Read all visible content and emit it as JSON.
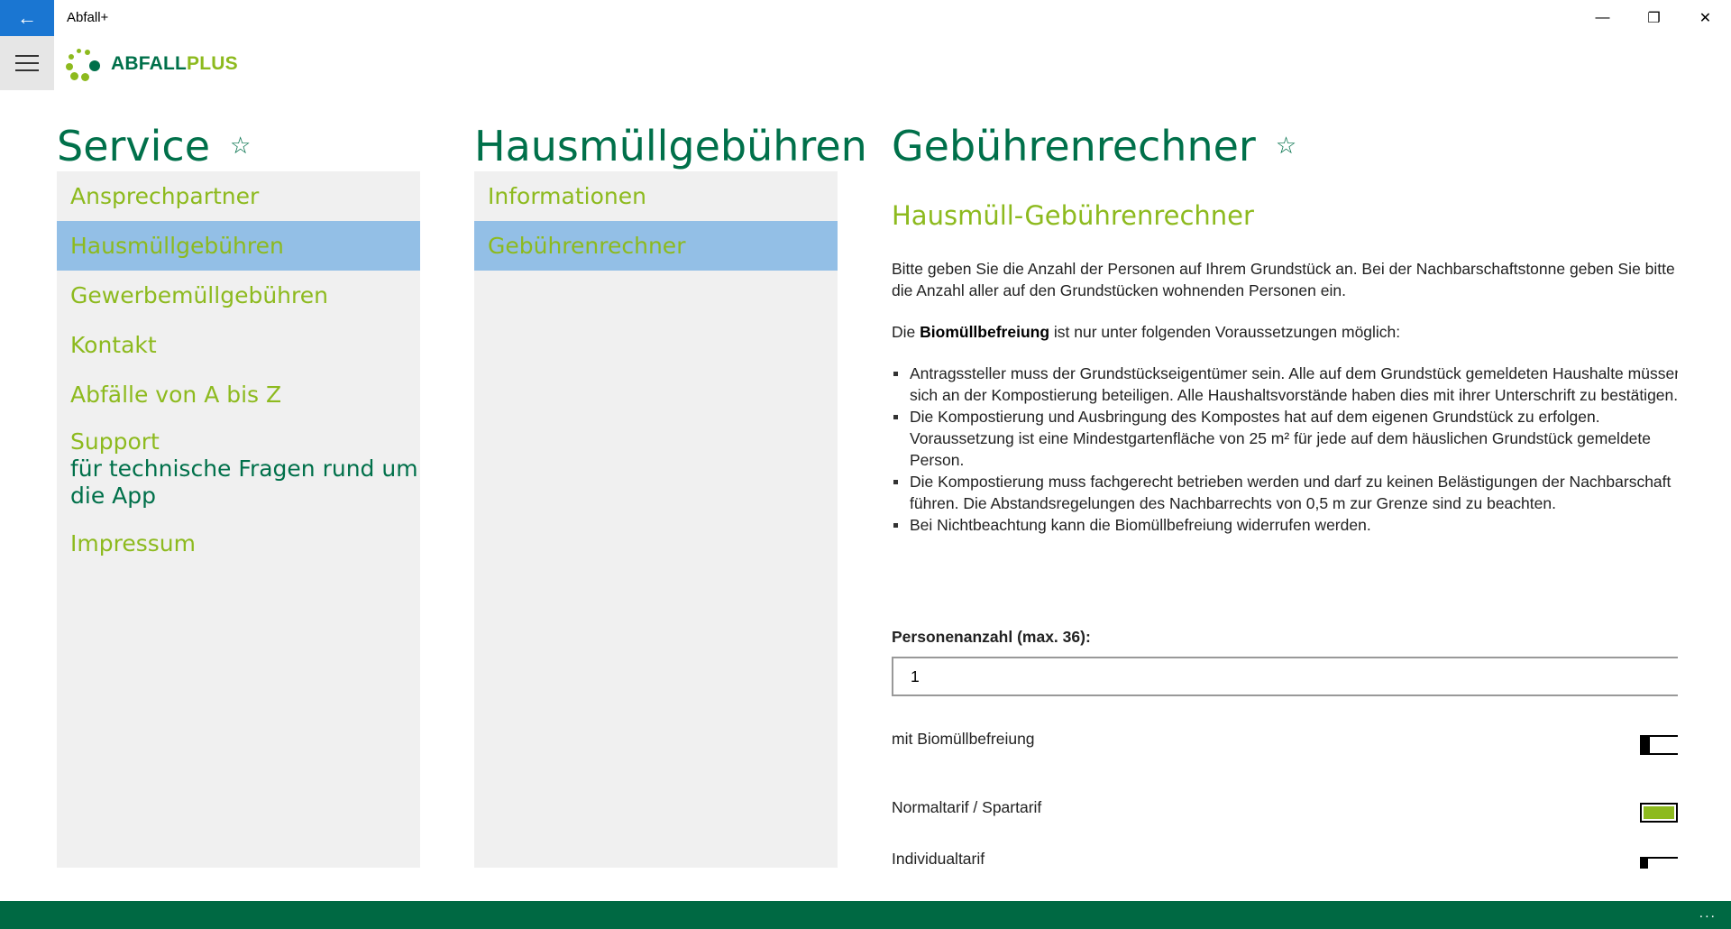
{
  "window": {
    "title": "Abfall+"
  },
  "logo": {
    "part1": "ABFALL",
    "part2": "PLUS"
  },
  "service": {
    "title": "Service",
    "items": [
      {
        "label": "Ansprechpartner"
      },
      {
        "label": "Hausmüllgebühren"
      },
      {
        "label": "Gewerbemüllgebühren"
      },
      {
        "label": "Kontakt"
      },
      {
        "label": "Abfälle von A bis Z"
      },
      {
        "label": "Support",
        "sub": "für technische Fragen rund um die App"
      },
      {
        "label": "Impressum"
      }
    ]
  },
  "hausmuell": {
    "title": "Hausmüllgebühren",
    "items": [
      {
        "label": "Informationen"
      },
      {
        "label": "Gebührenrechner"
      }
    ]
  },
  "rechner": {
    "title": "Gebührenrechner",
    "subtitle": "Hausmüll-Gebührenrechner",
    "intro": "Bitte geben Sie die Anzahl der Personen auf Ihrem Grundstück an. Bei der Nachbarschaftstonne geben Sie bitte die Anzahl aller auf den Grundstücken wohnenden Personen ein.",
    "bio_prefix": "Die ",
    "bio_bold": "Biomüllbefreiung",
    "bio_suffix": " ist nur unter folgenden Voraussetzungen möglich:",
    "bullets": [
      "Antragssteller muss der Grundstückseigentümer sein. Alle auf dem Grundstück gemeldeten Haushalte müssen sich an der Kompostierung beteiligen. Alle Haushaltsvorstände haben dies mit ihrer Unterschrift zu bestätigen.",
      "Die Kompostierung und Ausbringung des Kompostes hat auf dem eigenen Grundstück zu erfolgen. Voraussetzung ist eine Mindestgartenfläche von 25 m² für jede auf dem häuslichen Grundstück gemeldete Person.",
      "Die Kompostierung muss fachgerecht betrieben werden und darf zu keinen Belästigungen der Nachbarschaft führen. Die Abstandsregelungen des Nachbarrechts von 0,5 m zur Grenze sind zu beachten.",
      "Bei Nichtbeachtung kann die Biomüllbefreiung widerrufen werden."
    ],
    "persons_label": "Personenanzahl (max. 36):",
    "persons_value": "1",
    "toggle_bio": "mit Biomüllbefreiung",
    "toggle_normal": "Normaltarif / Spartarif",
    "toggle_individual": "Individualtarif"
  },
  "footer": {
    "more": "..."
  },
  "colors": {
    "primary_green": "#00704a",
    "accent_green": "#8dba1e",
    "selection_blue": "#93bfe6",
    "footer_green": "#006943",
    "back_blue": "#1a76d2"
  }
}
